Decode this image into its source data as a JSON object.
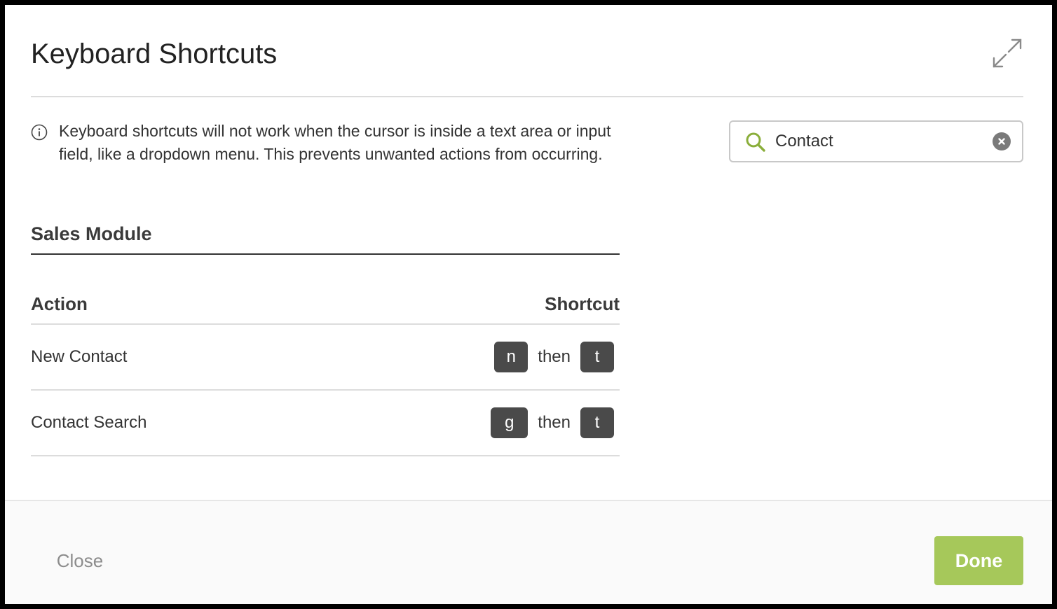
{
  "dialog": {
    "title": "Keyboard Shortcuts",
    "expand_icon": "expand-arrows-icon"
  },
  "info": {
    "icon": "info-circle-icon",
    "text": "Keyboard shortcuts will not work when the cursor is inside a text area or input field, like a dropdown menu. This prevents unwanted actions from occurring."
  },
  "search": {
    "icon": "search-icon",
    "value": "Contact",
    "clear_icon": "clear-circle-icon",
    "icon_color": "#8aae3a"
  },
  "section": {
    "title": "Sales Module"
  },
  "table": {
    "headers": {
      "action": "Action",
      "shortcut": "Shortcut"
    },
    "rows": [
      {
        "action": "New Contact",
        "key1": "n",
        "connector": "then",
        "key2": "t"
      },
      {
        "action": "Contact Search",
        "key1": "g",
        "connector": "then",
        "key2": "t"
      }
    ]
  },
  "footer": {
    "close_label": "Close",
    "done_label": "Done",
    "done_color": "#a6c85a"
  }
}
